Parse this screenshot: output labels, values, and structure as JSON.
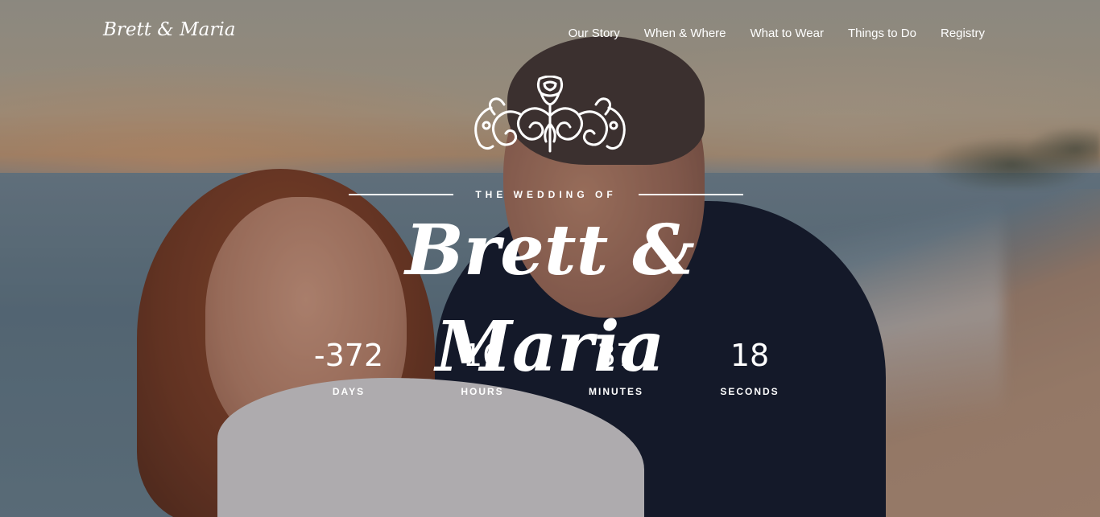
{
  "site": {
    "logo": "Brett & Maria"
  },
  "nav": {
    "items": [
      {
        "label": "Our Story"
      },
      {
        "label": "When & Where"
      },
      {
        "label": "What to Wear"
      },
      {
        "label": "Things to Do"
      },
      {
        "label": "Registry"
      }
    ]
  },
  "hero": {
    "ornament_icon": "rose-flourish-icon",
    "eyebrow": "THE WEDDING OF",
    "couple_names": "Brett & Maria"
  },
  "countdown": [
    {
      "value": "-372",
      "label": "DAYS"
    },
    {
      "value": "16",
      "label": "HOURS"
    },
    {
      "value": "37",
      "label": "MINUTES"
    },
    {
      "value": "18",
      "label": "SECONDS"
    }
  ],
  "colors": {
    "text": "#ffffff"
  }
}
